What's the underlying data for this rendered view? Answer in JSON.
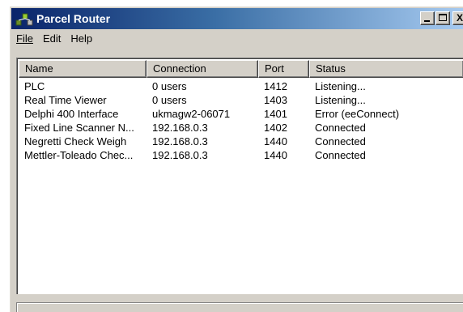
{
  "window": {
    "title": "Parcel Router",
    "app_icon": "router-icon",
    "controls": {
      "minimize": "minimize-icon",
      "maximize": "maximize-icon",
      "close_label": "X"
    }
  },
  "menu": {
    "file": "File",
    "edit": "Edit",
    "help": "Help"
  },
  "table": {
    "columns": [
      "Name",
      "Connection",
      "Port",
      "Status"
    ],
    "rows": [
      {
        "name": "PLC",
        "connection": "0 users",
        "port": "1412",
        "status": "Listening..."
      },
      {
        "name": "Real Time Viewer",
        "connection": "0 users",
        "port": "1403",
        "status": "Listening..."
      },
      {
        "name": "Delphi 400 Interface",
        "connection": "ukmagw2-06071",
        "port": "1401",
        "status": "Error (eeConnect)"
      },
      {
        "name": "Fixed Line Scanner N...",
        "connection": "192.168.0.3",
        "port": "1402",
        "status": "Connected"
      },
      {
        "name": "Negretti Check Weigh",
        "connection": "192.168.0.3",
        "port": "1440",
        "status": "Connected"
      },
      {
        "name": "Mettler-Toleado Chec...",
        "connection": "192.168.0.3",
        "port": "1440",
        "status": "Connected"
      }
    ]
  },
  "statusbar": {
    "text": ""
  }
}
